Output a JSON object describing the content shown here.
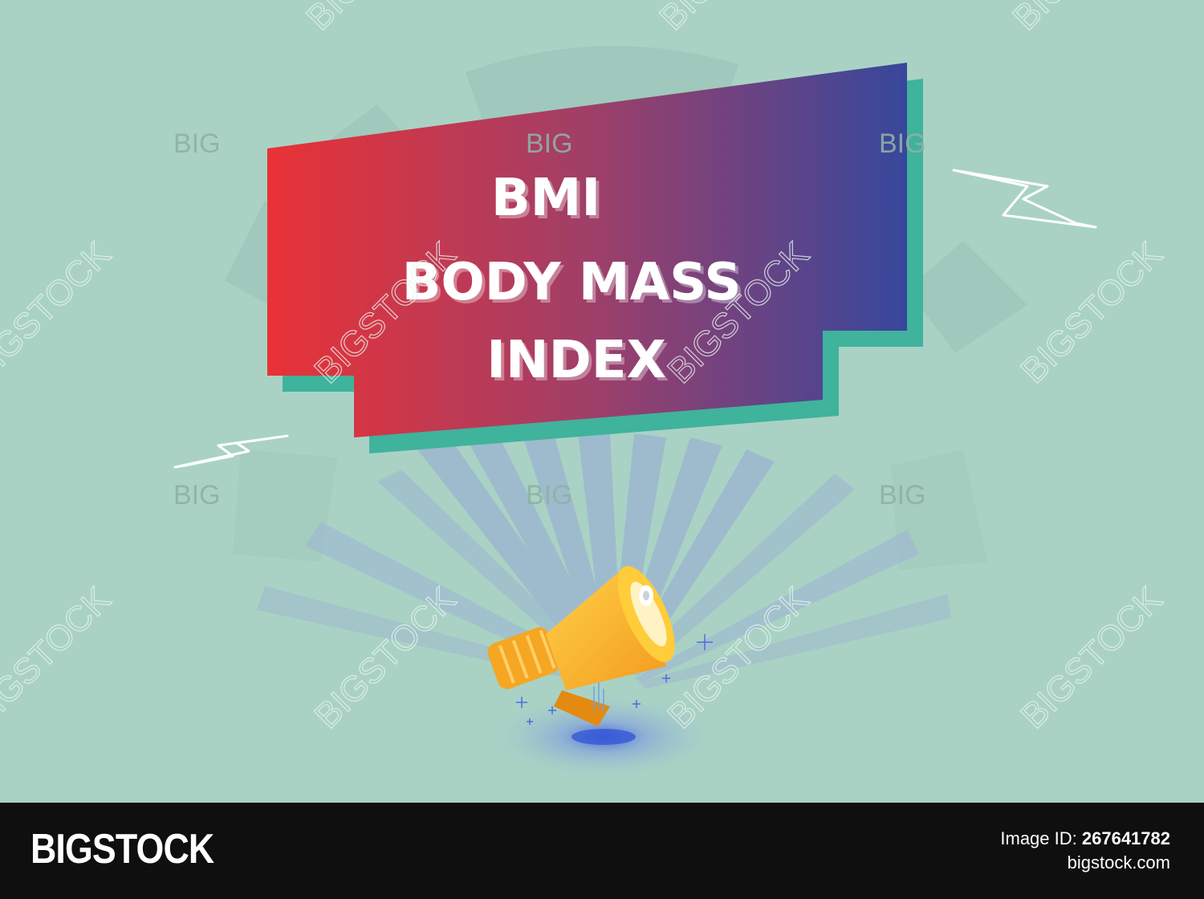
{
  "headline": {
    "line1": "BMI",
    "line2": "BODY MASS",
    "line3": "INDEX"
  },
  "watermarks": {
    "big": "BIG",
    "bigstock": "BIGSTOCK"
  },
  "footer": {
    "logo": "BIGSTOCK",
    "image_id_label": "Image ID:",
    "image_id": "267641782",
    "site": "bigstock.com"
  },
  "colors": {
    "background": "#a9d2c5",
    "banner_left": "#e93236",
    "banner_right": "#37479c",
    "banner_shadow": "#3fb39c",
    "megaphone": "#f5a623",
    "footer": "#0f0f10"
  }
}
